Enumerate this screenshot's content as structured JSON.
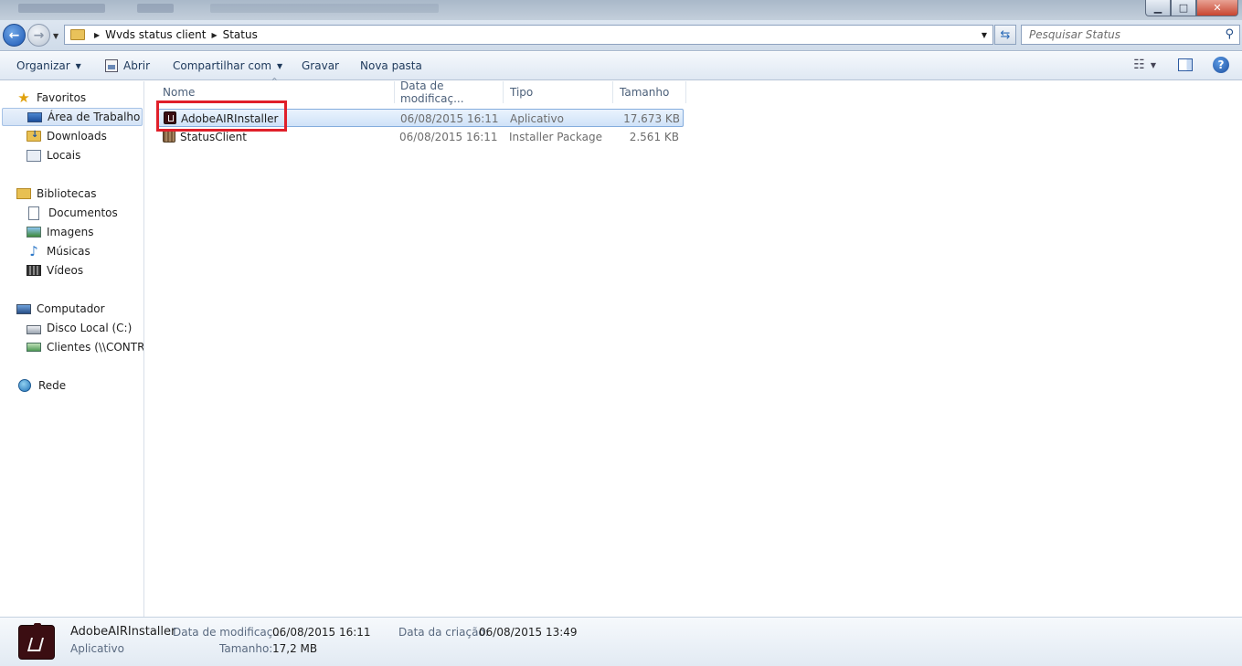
{
  "window": {
    "controls": {
      "minimize": "▁",
      "maximize": "□",
      "close": "✕"
    }
  },
  "address": {
    "breadcrumbs": [
      "Wvds status client",
      "Status"
    ],
    "search_placeholder": "Pesquisar Status"
  },
  "toolbar": {
    "organize": "Organizar",
    "open": "Abrir",
    "share": "Compartilhar com",
    "burn": "Gravar",
    "new_folder": "Nova pasta"
  },
  "nav": {
    "favorites": "Favoritos",
    "desktop": "Área de Trabalho",
    "downloads": "Downloads",
    "places": "Locais",
    "libraries": "Bibliotecas",
    "documents": "Documentos",
    "images": "Imagens",
    "music": "Músicas",
    "videos": "Vídeos",
    "computer": "Computador",
    "local_disk": "Disco Local (C:)",
    "clients": "Clientes (\\\\CONTRO",
    "network": "Rede"
  },
  "columns": {
    "name": "Nome",
    "date": "Data de modificaç...",
    "type": "Tipo",
    "size": "Tamanho"
  },
  "files": [
    {
      "name": "AdobeAIRInstaller",
      "date": "06/08/2015 16:11",
      "type": "Aplicativo",
      "size": "17.673 KB",
      "icon": "adobe-air-icon",
      "selected": true
    },
    {
      "name": "StatusClient",
      "date": "06/08/2015 16:11",
      "type": "Installer Package",
      "size": "2.561 KB",
      "icon": "installer-package-icon",
      "selected": false
    }
  ],
  "details": {
    "name": "AdobeAIRInstaller",
    "type": "Aplicativo",
    "modified_label": "Data de modificaç...",
    "modified_value": "06/08/2015 16:11",
    "size_label": "Tamanho:",
    "size_value": "17,2 MB",
    "created_label": "Data da criação:",
    "created_value": "06/08/2015 13:49"
  },
  "colors": {
    "highlight_box": "#e0202a",
    "selection": "#cfe2f8",
    "toolbar_text": "#1e395b"
  }
}
